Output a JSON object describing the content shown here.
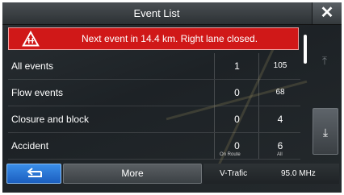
{
  "header": {
    "title": "Event List",
    "close_icon": "close-x-icon"
  },
  "alert": {
    "text": "Next event in 14.4 km. Right lane closed.",
    "icon": "lane-closed-warning-icon",
    "color": "#d01818"
  },
  "events": [
    {
      "name": "All events",
      "on_route": "1",
      "all": "105"
    },
    {
      "name": "Flow events",
      "on_route": "0",
      "all": "68"
    },
    {
      "name": "Closure and block",
      "on_route": "0",
      "all": "4"
    },
    {
      "name": "Accident",
      "on_route": "0",
      "all": "6"
    }
  ],
  "columns": {
    "on_route": "On Route",
    "all": "All"
  },
  "scroll": {
    "up_icon": "scroll-top-icon",
    "down_icon": "scroll-bottom-icon"
  },
  "footer": {
    "back_icon": "back-arrow-icon",
    "more_label": "More",
    "station": "V-Trafic",
    "frequency": "95.0 MHz"
  },
  "colors": {
    "back_button": "#2a7ad8",
    "alert": "#d01818"
  }
}
